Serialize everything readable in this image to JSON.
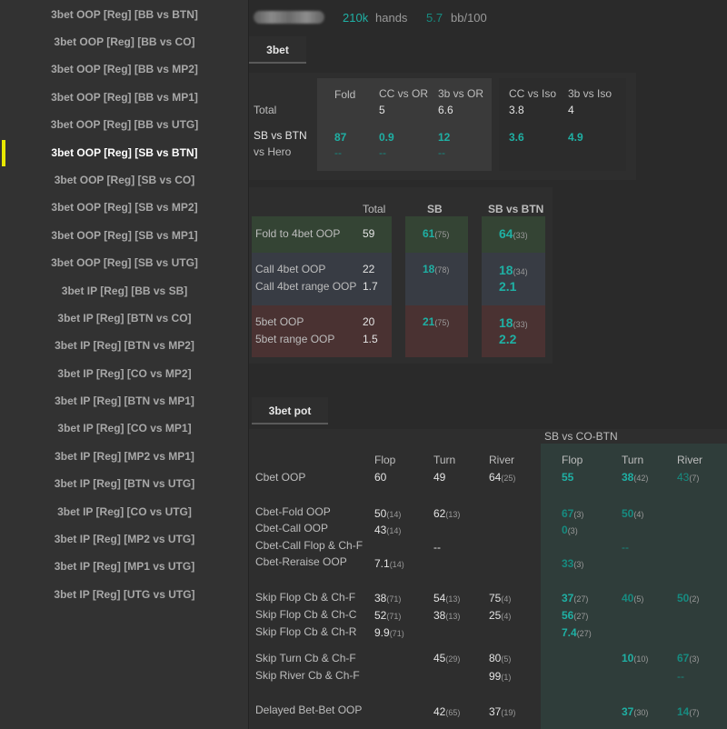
{
  "sidebar": {
    "items": [
      "3bet OOP [Reg] [BB vs BTN]",
      "3bet OOP [Reg] [BB vs CO]",
      "3bet OOP [Reg] [BB vs MP2]",
      "3bet OOP [Reg] [BB vs MP1]",
      "3bet OOP [Reg] [BB vs UTG]",
      "3bet OOP [Reg] [SB vs BTN]",
      "3bet OOP [Reg] [SB vs CO]",
      "3bet OOP [Reg] [SB vs MP2]",
      "3bet OOP [Reg] [SB vs MP1]",
      "3bet OOP [Reg] [SB vs UTG]",
      "3bet IP [Reg] [BB vs SB]",
      "3bet IP [Reg] [BTN vs CO]",
      "3bet IP [Reg] [BTN vs MP2]",
      "3bet IP [Reg] [CO vs MP2]",
      "3bet IP [Reg] [BTN vs MP1]",
      "3bet IP [Reg] [CO vs MP1]",
      "3bet IP [Reg] [MP2 vs MP1]",
      "3bet IP [Reg] [BTN vs UTG]",
      "3bet IP [Reg] [CO vs UTG]",
      "3bet IP [Reg] [MP2 vs UTG]",
      "3bet IP [Reg] [MP1 vs UTG]",
      "3bet IP [Reg] [UTG vs UTG]"
    ],
    "active_index": 5
  },
  "header": {
    "hands_value": "210k",
    "hands_label": "hands",
    "bb_value": "5.7",
    "bb_label": "bb/100"
  },
  "tabs": {
    "tab1": "3bet",
    "tab2": "3bet pot"
  },
  "panel1": {
    "headers": [
      "Fold",
      "CC vs OR",
      "3b vs OR",
      "CC vs Iso",
      "3b vs Iso"
    ],
    "total_label": "Total",
    "total_values": [
      "5",
      "6.6",
      "3.8",
      "4"
    ],
    "sb_label": "SB vs BTN",
    "sb_values": [
      "87",
      "0.9",
      "12",
      "3.6",
      "4.9"
    ],
    "hero_label": "vs Hero",
    "hero_values": [
      "--",
      "--",
      "--"
    ]
  },
  "panel2": {
    "headers": {
      "total": "Total",
      "sb": "SB",
      "sbbtn": "SB vs BTN"
    },
    "fold4": {
      "label": "Fold to 4bet OOP",
      "total": "59",
      "sb": "61",
      "sb_n": "(75)",
      "sbbtn": "64",
      "sbbtn_n": "(33)"
    },
    "call4": {
      "label": "Call 4bet OOP",
      "total": "22",
      "sb": "18",
      "sb_n": "(78)",
      "sbbtn": "18",
      "sbbtn_n": "(34)"
    },
    "call4range": {
      "label": "Call 4bet range OOP",
      "total": "1.7",
      "sbbtn": "2.1"
    },
    "bet5": {
      "label": "5bet OOP",
      "total": "20",
      "sb": "21",
      "sb_n": "(75)",
      "sbbtn": "18",
      "sbbtn_n": "(33)"
    },
    "bet5range": {
      "label": "5bet range OOP",
      "total": "1.5",
      "sbbtn": "2.2"
    }
  },
  "panel3": {
    "group_title": "SB vs CO-BTN",
    "col_headers": [
      "Flop",
      "Turn",
      "River"
    ],
    "rows": {
      "cbet": {
        "label": "Cbet OOP",
        "flop": "60",
        "turn": "49",
        "river": "64",
        "river_n": "(25)",
        "g_flop": "55",
        "g_turn": "38",
        "g_turn_n": "(42)",
        "g_river": "43",
        "g_river_n": "(7)"
      },
      "cbfold": {
        "label": "Cbet-Fold OOP",
        "flop": "50",
        "flop_n": "(14)",
        "turn": "62",
        "turn_n": "(13)",
        "g_flop": "67",
        "g_flop_n": "(3)",
        "g_turn": "50",
        "g_turn_n": "(4)"
      },
      "cbcall": {
        "label": "Cbet-Call OOP",
        "flop": "43",
        "flop_n": "(14)",
        "g_flop": "0",
        "g_flop_n": "(3)"
      },
      "cbcallch": {
        "label": "Cbet-Call Flop & Ch-F",
        "turn": "--",
        "g_turn": "--"
      },
      "cbraise": {
        "label": "Cbet-Reraise OOP",
        "flop": "7.1",
        "flop_n": "(14)",
        "g_flop": "33",
        "g_flop_n": "(3)"
      },
      "skf": {
        "label": "Skip Flop Cb & Ch-F",
        "flop": "38",
        "flop_n": "(71)",
        "turn": "54",
        "turn_n": "(13)",
        "river": "75",
        "river_n": "(4)",
        "g_flop": "37",
        "g_flop_n": "(27)",
        "g_turn": "40",
        "g_turn_n": "(5)",
        "g_river": "50",
        "g_river_n": "(2)"
      },
      "skc": {
        "label": "Skip Flop Cb & Ch-C",
        "flop": "52",
        "flop_n": "(71)",
        "turn": "38",
        "turn_n": "(13)",
        "river": "25",
        "river_n": "(4)",
        "g_flop": "56",
        "g_flop_n": "(27)"
      },
      "skr": {
        "label": "Skip Flop Cb & Ch-R",
        "flop": "9.9",
        "flop_n": "(71)",
        "g_flop": "7.4",
        "g_flop_n": "(27)"
      },
      "skt": {
        "label": "Skip Turn Cb & Ch-F",
        "turn": "45",
        "turn_n": "(29)",
        "river": "80",
        "river_n": "(5)",
        "g_turn": "10",
        "g_turn_n": "(10)",
        "g_river": "67",
        "g_river_n": "(3)"
      },
      "skrv": {
        "label": "Skip River Cb & Ch-F",
        "river": "99",
        "river_n": "(1)",
        "g_river": "--"
      },
      "delayed": {
        "label": "Delayed Bet-Bet OOP",
        "turn": "42",
        "turn_n": "(65)",
        "river": "37",
        "river_n": "(19)",
        "g_turn": "37",
        "g_turn_n": "(30)",
        "g_river": "14",
        "g_river_n": "(7)"
      }
    }
  },
  "colors": {
    "teal": "#1fb0a4",
    "dark_teal": "#178b80",
    "fold_row": "#344434",
    "call_row": "#383c44",
    "bet5_row": "#4a3232",
    "group_bg": "#2f3d3a",
    "active_marker": "#e8e800"
  }
}
